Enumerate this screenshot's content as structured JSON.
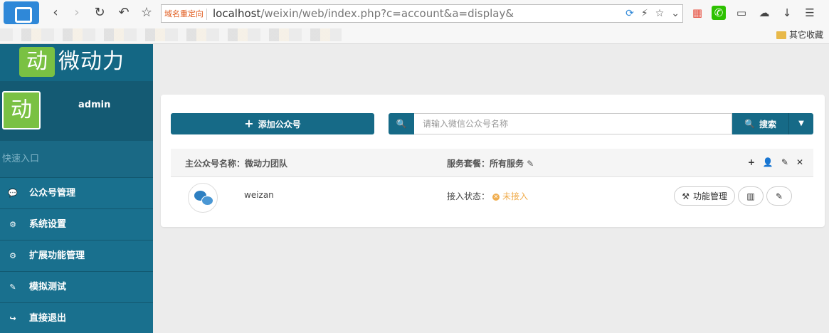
{
  "browser": {
    "address_tag": "域名重定向",
    "url_host": "localhost",
    "url_path": "/weixin/web/index.php?c=account&a=display&",
    "bookmark_folder": "其它收藏"
  },
  "sidebar": {
    "brand_logo_char": "动",
    "brand_text": "微动力",
    "avatar_char": "动",
    "username": "admin",
    "quick_entry": "快速入口",
    "items": [
      {
        "icon": "chat-icon",
        "glyph": "💬",
        "label": "公众号管理"
      },
      {
        "icon": "gear-icon",
        "glyph": "⚙",
        "label": "系统设置"
      },
      {
        "icon": "gears-icon",
        "glyph": "⚙",
        "label": "扩展功能管理"
      },
      {
        "icon": "edit-icon",
        "glyph": "✎",
        "label": "模拟测试"
      },
      {
        "icon": "logout-icon",
        "glyph": "↪",
        "label": "直接退出"
      }
    ]
  },
  "main": {
    "add_button": "添加公众号",
    "search_placeholder": "请输入微信公众号名称",
    "search_button": "搜索",
    "account_group": {
      "name_label": "主公众号名称：微动力团队",
      "service_label": "服务套餐：所有服务"
    },
    "rows": [
      {
        "name": "weizan",
        "status_label": "接入状态：",
        "status_value": "未接入",
        "manage_button": "功能管理"
      }
    ]
  },
  "colors": {
    "primary": "#166a87",
    "sidebar": "#19708e",
    "brand_green": "#7ac143",
    "warning": "#f0ad4e"
  }
}
